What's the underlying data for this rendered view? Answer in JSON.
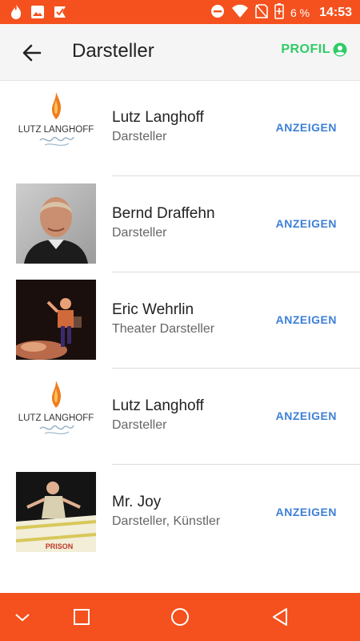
{
  "status_bar": {
    "battery_percent": "6 %",
    "time": "14:53",
    "icons": [
      "fire-icon",
      "image-icon",
      "check-flag-icon",
      "do-not-disturb-icon",
      "wifi-icon",
      "no-sim-icon",
      "battery-icon"
    ]
  },
  "app_bar": {
    "title": "Darsteller",
    "profile_label": "PROFIL",
    "back_icon": "arrow-left-icon",
    "profile_icon": "account-circle-icon"
  },
  "list": {
    "items": [
      {
        "name": "Lutz Langhoff",
        "role": "Darsteller",
        "action": "ANZEIGEN",
        "image": "logo",
        "logo_text": "LUTZ LANGHOFF"
      },
      {
        "name": "Bernd Draffehn",
        "role": "Darsteller",
        "action": "ANZEIGEN",
        "image": "portrait"
      },
      {
        "name": "Eric Wehrlin",
        "role": "Theater Darsteller",
        "action": "ANZEIGEN",
        "image": "stage"
      },
      {
        "name": "Lutz Langhoff",
        "role": "Darsteller",
        "action": "ANZEIGEN",
        "image": "logo",
        "logo_text": "LUTZ LANGHOFF"
      },
      {
        "name": "Mr. Joy",
        "role": "Darsteller, Künstler",
        "action": "ANZEIGEN",
        "image": "banner",
        "banner_text": "PRISON"
      }
    ]
  },
  "nav_bar": {
    "icons": [
      "chevron-down-icon",
      "square-icon",
      "circle-icon",
      "triangle-back-icon"
    ]
  },
  "colors": {
    "accent": "#f4511e",
    "profile": "#2fcc66",
    "action": "#3d7fd6"
  }
}
